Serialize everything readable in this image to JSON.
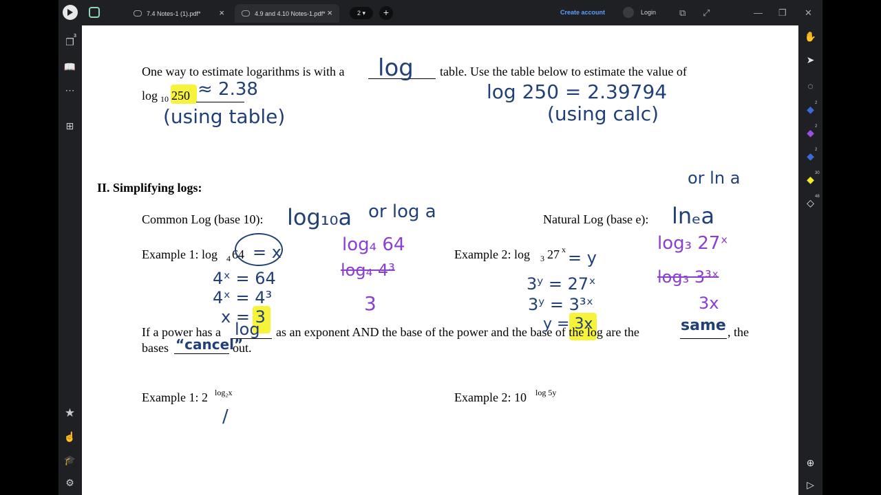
{
  "tabs": [
    {
      "label": "7.4 Notes-1 (1).pdf*"
    },
    {
      "label": "4.9 and 4.10 Notes-1.pdf*"
    }
  ],
  "tab_count": "2",
  "topbar": {
    "create_account": "Create account",
    "login": "Login"
  },
  "leftbar": {
    "badge_count": "3"
  },
  "rightbar": {
    "counts": [
      "2",
      "2",
      "2",
      "30",
      "48"
    ]
  },
  "colors": {
    "highlight": "#f6f33a",
    "ink_blue": "#213f78",
    "ink_purple": "#8a3fd0",
    "link": "#5aa0ff"
  },
  "doc": {
    "intro_a": "One way to estimate logarithms is with a",
    "intro_b": "table. Use the table below to estimate the value of",
    "log_prefix": "log",
    "log_sub": "10",
    "log_value": "250",
    "section_title": "II.  Simplifying logs:",
    "common_log": "Common Log (base 10):",
    "natural_log": "Natural Log (base e):",
    "ex1_label": "Example 1:  log",
    "ex1_sub": "4",
    "ex1_val": "64",
    "ex2_label": "Example 2:  log",
    "ex2_sub": "3",
    "ex2_val": "27",
    "ex2_sup": "x",
    "rule_a": "If a power has a",
    "rule_b": "as an exponent AND the base of the power and the base of the log are the",
    "rule_c": ", the",
    "rule_d": "bases",
    "rule_e": "out.",
    "ex3_label": "Example 1: 2",
    "ex3_sup": "log₂x",
    "ex4_label": "Example 2: 10",
    "ex4_sup": "log 5y"
  },
  "handwriting": {
    "blank_log": "log",
    "approx": "≈ 2.38",
    "using_table": "(using table)",
    "calc_line": "log 250 = 2.39794",
    "using_calc": "(using calc)",
    "or_ln_a": "or ln a",
    "log10_a": "log₁₀a",
    "or_log_a": "or log a",
    "ln_e_a": "lnₑa",
    "eq_x": "= x",
    "c1": "4ˣ = 64",
    "c2": "4ˣ = 4³",
    "c3": "x = 3",
    "p1": "log₄ 64",
    "p2": "log₄ 4³",
    "p3": "3",
    "eq_y": "= y",
    "d1": "3ʸ = 27ˣ",
    "d2": "3ʸ = 3³ˣ",
    "d3": "y = 3x",
    "q1": "log₃ 27ˣ",
    "q2": "log₃ 3³ˣ",
    "q3": "3x",
    "same": "same",
    "cancel": "“cancel”",
    "ex3_ans": "/"
  }
}
